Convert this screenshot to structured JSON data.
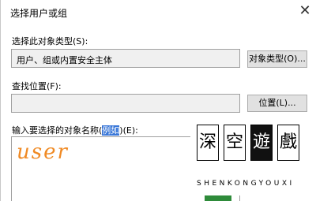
{
  "dialog": {
    "title": "选择用户或组",
    "close_glyph": "✕"
  },
  "object_type": {
    "label": "选择此对象类型(S):",
    "value": "用户、组或内置安全主体",
    "button": "对象类型(O)..."
  },
  "location": {
    "label": "查找位置(F):",
    "value": "",
    "button": "位置(L)..."
  },
  "names": {
    "label_prefix": "输入要选择的对象名称(",
    "label_highlight": "例如",
    "label_suffix": ")(E):",
    "value": "user"
  },
  "watermark": {
    "chars": [
      "深",
      "空",
      "遊",
      "戲"
    ],
    "sub": "SHENKONGYOUXI"
  },
  "colors": {
    "accent": "#3b78d8",
    "handwriting": "#f08a24"
  }
}
